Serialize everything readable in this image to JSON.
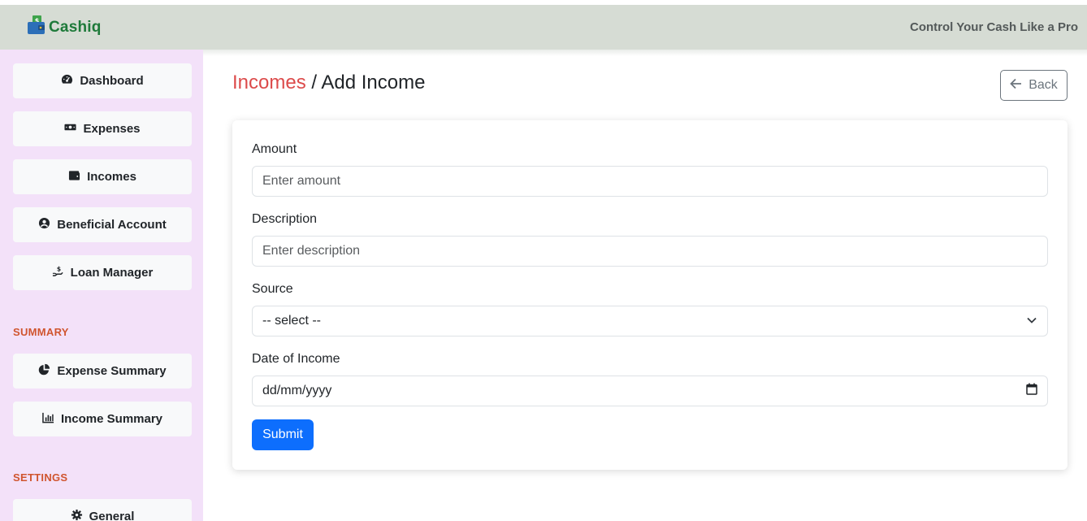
{
  "app": {
    "name": "Cashiq",
    "tagline": "Control Your Cash Like a Pro"
  },
  "sidebar": {
    "items": [
      {
        "label": "Dashboard",
        "icon": "dashboard-gauge-icon"
      },
      {
        "label": "Expenses",
        "icon": "money-bill-icon"
      },
      {
        "label": "Incomes",
        "icon": "wallet-icon"
      },
      {
        "label": "Beneficial Account",
        "icon": "user-circle-icon"
      },
      {
        "label": "Loan Manager",
        "icon": "hand-holding-dollar-icon"
      }
    ],
    "summary_label": "SUMMARY",
    "summary_items": [
      {
        "label": "Expense Summary",
        "icon": "pie-chart-icon"
      },
      {
        "label": "Income Summary",
        "icon": "bar-chart-icon"
      }
    ],
    "settings_label": "SETTINGS",
    "settings_items": [
      {
        "label": "General",
        "icon": "gear-icon"
      }
    ]
  },
  "page": {
    "breadcrumb_parent": "Incomes",
    "breadcrumb_separator": " / ",
    "title": "Add Income",
    "back_label": "Back"
  },
  "form": {
    "amount_label": "Amount",
    "amount_placeholder": "Enter amount",
    "description_label": "Description",
    "description_placeholder": "Enter description",
    "source_label": "Source",
    "source_selected": "-- select --",
    "date_label": "Date of Income",
    "date_placeholder": "dd/mm/yyyy",
    "submit_label": "Submit"
  },
  "colors": {
    "header_bg": "#d6dcd4",
    "sidebar_bg": "#f3e1f9",
    "breadcrumb_accent": "#dc4b4b",
    "section_label": "#d0552f",
    "primary": "#0d6efd",
    "brand": "#1e7a3a"
  }
}
